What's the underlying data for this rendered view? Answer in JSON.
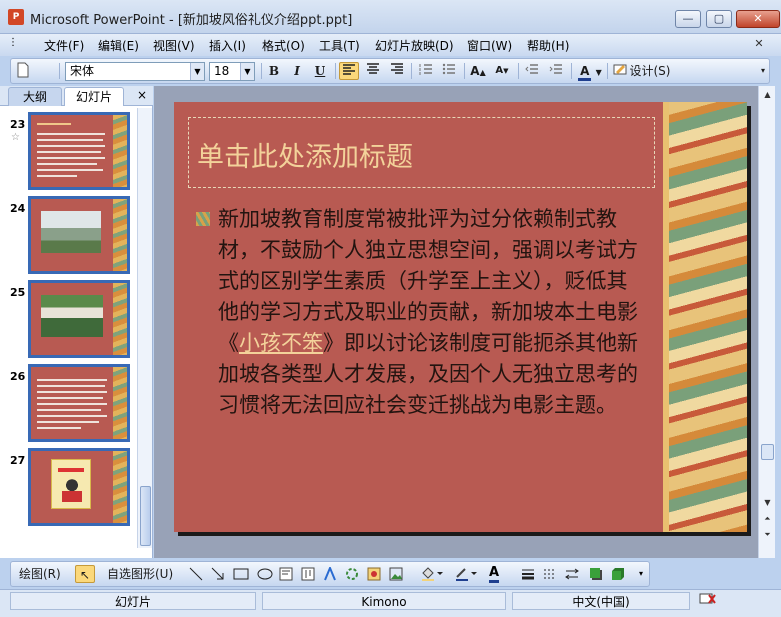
{
  "window": {
    "app_icon": "P",
    "title": "Microsoft PowerPoint - [新加坡风俗礼仪介绍ppt.ppt]",
    "minimize": "—",
    "restore": "▢",
    "close": "✕"
  },
  "menu": {
    "items": [
      {
        "label": "文件(F)"
      },
      {
        "label": "编辑(E)"
      },
      {
        "label": "视图(V)"
      },
      {
        "label": "插入(I)"
      },
      {
        "label": "格式(O)"
      },
      {
        "label": "工具(T)"
      },
      {
        "label": "幻灯片放映(D)"
      },
      {
        "label": "窗口(W)"
      },
      {
        "label": "帮助(H)"
      }
    ],
    "doc_close": "✕"
  },
  "toolbar": {
    "font": "宋体",
    "size": "18",
    "bold": "B",
    "italic": "I",
    "underline": "U",
    "design_label": "设计(S)"
  },
  "pane": {
    "tab_outline": "大纲",
    "tab_slides": "幻灯片",
    "close": "×",
    "slides": [
      {
        "num": "23",
        "star": "☆"
      },
      {
        "num": "24",
        "star": ""
      },
      {
        "num": "25",
        "star": ""
      },
      {
        "num": "26",
        "star": ""
      },
      {
        "num": "27",
        "star": ""
      }
    ]
  },
  "slide": {
    "title_placeholder": "单击此处添加标题",
    "body_before": "新加坡教育制度常被批评为过分依赖制式教材，不鼓励个人独立思想空间，强调以考试方式的区别学生素质（升学至上主义），贬低其他的学习方式及职业的贡献，新加坡本土电影《",
    "movie": "小孩不笨",
    "body_after": "》即以讨论该制度可能扼杀其他新加坡各类型人才发展，及因个人无独立思考的习惯将无法回应社会变迁挑战为电影主题。"
  },
  "drawbar": {
    "draw_label": "绘图(R)",
    "autoshape_label": "自选图形(U)"
  },
  "status": {
    "view": "幻灯片",
    "theme": "Kimono",
    "language": "中文(中国)"
  }
}
